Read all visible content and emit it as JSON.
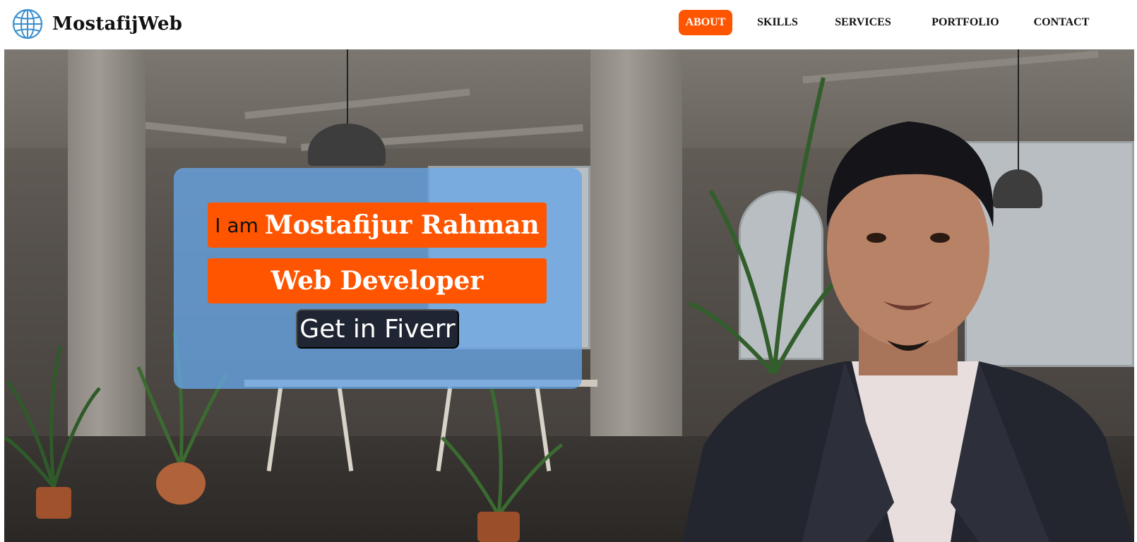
{
  "brand": {
    "name": "MostafijWeb",
    "icon": "globe-icon"
  },
  "nav": {
    "items": [
      {
        "label": "ABOUT",
        "active": true
      },
      {
        "label": "SKILLS",
        "active": false
      },
      {
        "label": "SERVICES",
        "active": false
      },
      {
        "label": "PORTFOLIO",
        "active": false
      },
      {
        "label": "CONTACT",
        "active": false
      }
    ]
  },
  "hero": {
    "intro": "I am",
    "name": "Mostafijur Rahman",
    "role": "Web Developer",
    "cta_label": "Get in Fiverr"
  },
  "colors": {
    "accent": "#ff5500",
    "card": "#67a5e6",
    "cta_bg": "#1f2532",
    "text_dark": "#111111"
  }
}
